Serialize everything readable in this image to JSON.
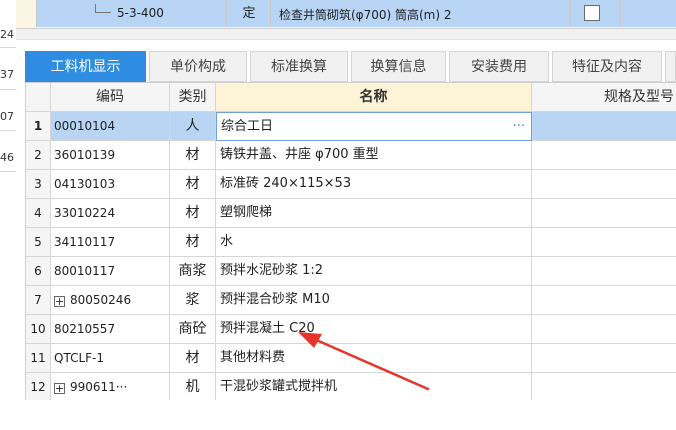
{
  "left_gutter": [
    "24",
    "37",
    "07",
    "46"
  ],
  "parent_row": {
    "code": "5-3-400",
    "type": "定",
    "name": "检查井筒砌筑(φ700) 筒高(m) 2",
    "checkbox_checked": false
  },
  "tabs": [
    {
      "label": "工料机显示",
      "active": true
    },
    {
      "label": "单价构成",
      "active": false
    },
    {
      "label": "标准换算",
      "active": false
    },
    {
      "label": "换算信息",
      "active": false
    },
    {
      "label": "安装费用",
      "active": false
    },
    {
      "label": "特征及内容",
      "active": false
    }
  ],
  "grid": {
    "columns": {
      "code": "编码",
      "type": "类别",
      "name": "名称",
      "spec": "规格及型号"
    },
    "rows": [
      {
        "num": "1",
        "code": "00010104",
        "type": "人",
        "name": "综合工日",
        "selected": true,
        "expandable": false
      },
      {
        "num": "2",
        "code": "36010139",
        "type": "材",
        "name": "铸铁井盖、井座 φ700 重型",
        "selected": false,
        "expandable": false
      },
      {
        "num": "3",
        "code": "04130103",
        "type": "材",
        "name": "标准砖 240×115×53",
        "selected": false,
        "expandable": false
      },
      {
        "num": "4",
        "code": "33010224",
        "type": "材",
        "name": "塑钢爬梯",
        "selected": false,
        "expandable": false
      },
      {
        "num": "5",
        "code": "34110117",
        "type": "材",
        "name": "水",
        "selected": false,
        "expandable": false
      },
      {
        "num": "6",
        "code": "80010117",
        "type": "商浆",
        "name": "预拌水泥砂浆 1:2",
        "selected": false,
        "expandable": false
      },
      {
        "num": "7",
        "code": "80050246",
        "type": "浆",
        "name": "预拌混合砂浆 M10",
        "selected": false,
        "expandable": true
      },
      {
        "num": "10",
        "code": "80210557",
        "type": "商砼",
        "name": "预拌混凝土 C20",
        "selected": false,
        "expandable": false
      },
      {
        "num": "11",
        "code": "QTCLF-1",
        "type": "材",
        "name": "其他材料费",
        "selected": false,
        "expandable": false
      },
      {
        "num": "12",
        "code": "990611···",
        "type": "机",
        "name": "干混砂浆罐式搅拌机",
        "selected": false,
        "expandable": true
      }
    ]
  },
  "ellipsis_label": "···",
  "expand_glyph": "+",
  "colors": {
    "accent_tab": "#2e8de0",
    "selected_row": "#b9d5f3",
    "name_header": "#fdf3d7",
    "arrow": "#e8352b"
  }
}
